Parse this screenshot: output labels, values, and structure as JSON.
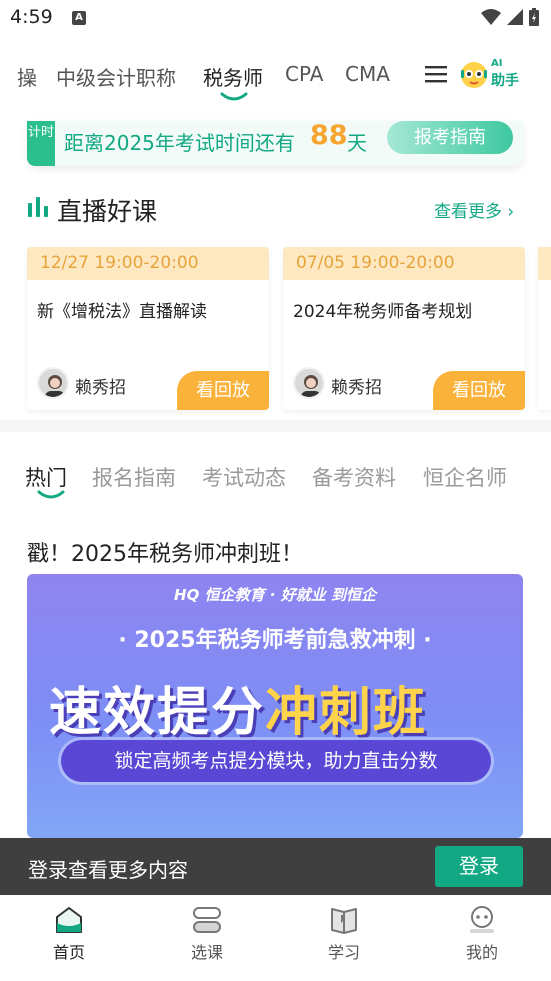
{
  "status_bar": {
    "time": "4:59"
  },
  "top_tabs": [
    {
      "label": "操"
    },
    {
      "label": "中级会计职称"
    },
    {
      "label": "税务师"
    },
    {
      "label": "CPA"
    },
    {
      "label": "CMA"
    }
  ],
  "ai_assistant": {
    "badge": "AI",
    "label": "助手"
  },
  "countdown": {
    "tag": "计时",
    "prefix": "距离2025年考试时间还有",
    "days": "88",
    "unit": "天",
    "button": "报考指南"
  },
  "live_section": {
    "title": "直播好课",
    "more": "查看更多 ›",
    "cards": [
      {
        "time": "12/27 19:00-20:00",
        "title": "新《增税法》直播解读",
        "teacher": "赖秀招",
        "button": "看回放"
      },
      {
        "time": "07/05 19:00-20:00",
        "title": "2024年税务师备考规划",
        "teacher": "赖秀招",
        "button": "看回放"
      }
    ]
  },
  "category_tabs": [
    {
      "label": "热门"
    },
    {
      "label": "报名指南"
    },
    {
      "label": "考试动态"
    },
    {
      "label": "备考资料"
    },
    {
      "label": "恒企名师"
    }
  ],
  "article": {
    "title": "戳！2025年税务师冲刺班！",
    "banner": {
      "brand": "HQ 恒企教育 · 好就业 到恒企",
      "subtitle": "· 2025年税务师考前急救冲刺 ·",
      "main_left": "速效提分",
      "main_right": "冲刺班",
      "pill": "锁定高频考点提分模块，助力直击分数"
    }
  },
  "login_bar": {
    "text": "登录查看更多内容",
    "button": "登录"
  },
  "bottom_nav": [
    {
      "label": "首页",
      "icon": "home-icon"
    },
    {
      "label": "选课",
      "icon": "course-icon"
    },
    {
      "label": "学习",
      "icon": "book-icon"
    },
    {
      "label": "我的",
      "icon": "profile-icon"
    }
  ],
  "colors": {
    "accent": "#13a884",
    "orange": "#fbb23a",
    "number": "#f7a531"
  }
}
